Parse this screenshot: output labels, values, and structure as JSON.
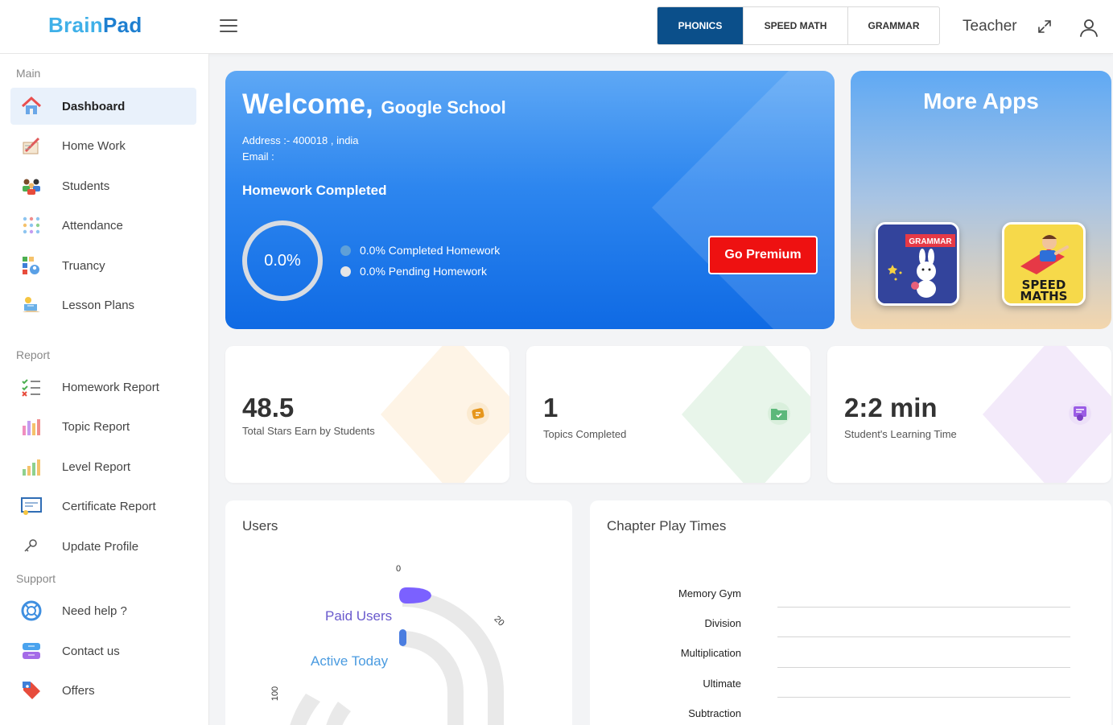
{
  "header": {
    "logo_part1": "Brain",
    "logo_part2": "Pad",
    "tabs": [
      {
        "label": "PHONICS",
        "active": true
      },
      {
        "label": "SPEED MATH",
        "active": false
      },
      {
        "label": "GRAMMAR",
        "active": false
      }
    ],
    "role": "Teacher",
    "icons": [
      "hamburger-menu-icon",
      "expand-icon",
      "user-icon"
    ]
  },
  "sidebar": {
    "sections": {
      "main": "Main",
      "report": "Report",
      "support": "Support"
    },
    "items": [
      {
        "label": "Dashboard",
        "icon": "house-icon",
        "active": true
      },
      {
        "label": "Home Work",
        "icon": "notebook-icon"
      },
      {
        "label": "Students",
        "icon": "students-icon"
      },
      {
        "label": "Attendance",
        "icon": "attendance-icon"
      },
      {
        "label": "Truancy",
        "icon": "truancy-icon"
      },
      {
        "label": "Lesson Plans",
        "icon": "lesson-plans-icon"
      },
      {
        "label": "Homework Report",
        "icon": "checklist-icon"
      },
      {
        "label": "Topic Report",
        "icon": "bar-chart-icon"
      },
      {
        "label": "Level Report",
        "icon": "level-chart-icon"
      },
      {
        "label": "Certificate Report",
        "icon": "certificate-icon"
      },
      {
        "label": "Update Profile",
        "icon": "key-icon"
      },
      {
        "label": "Need help ?",
        "icon": "lifebuoy-icon"
      },
      {
        "label": "Contact us",
        "icon": "contact-icon"
      },
      {
        "label": "Offers",
        "icon": "tag-icon"
      }
    ]
  },
  "welcome": {
    "greeting": "Welcome,",
    "school": "Google School",
    "address": "Address :- 400018 , india",
    "email": "Email :",
    "homework_title": "Homework Completed",
    "ring_value": "0.0%",
    "legend_completed": "0.0% Completed Homework",
    "legend_pending": "0.0% Pending Homework",
    "premium_button": "Go Premium",
    "colors": {
      "completed_dot": "#5fa0d8",
      "pending_dot": "#e6e6e6",
      "premium": "#ee1111"
    }
  },
  "more_apps": {
    "title": "More Apps",
    "apps": [
      {
        "name": "GRAMMAR",
        "icon": "grammar-bunny-icon"
      },
      {
        "name": "SPEED MATHS",
        "icon": "speed-maths-hero-icon"
      }
    ]
  },
  "stats": [
    {
      "value": "48.5",
      "label": "Total Stars Earn by Students",
      "icon": "star-badge-icon",
      "accent": "#f5a623"
    },
    {
      "value": "1",
      "label": "Topics Completed",
      "icon": "folder-check-icon",
      "accent": "#5cb87a"
    },
    {
      "value": "2:2 min",
      "label": "Student's Learning Time",
      "icon": "certificate-ribbon-icon",
      "accent": "#9b5de5"
    }
  ],
  "users_panel": {
    "title": "Users",
    "series": [
      "Paid Users",
      "Active Today"
    ],
    "ticks": [
      "0",
      "20",
      "100"
    ]
  },
  "chapter_panel": {
    "title": "Chapter Play Times",
    "categories": [
      "Memory Gym",
      "Division",
      "Multiplication",
      "Ultimate",
      "Subtraction"
    ]
  }
}
